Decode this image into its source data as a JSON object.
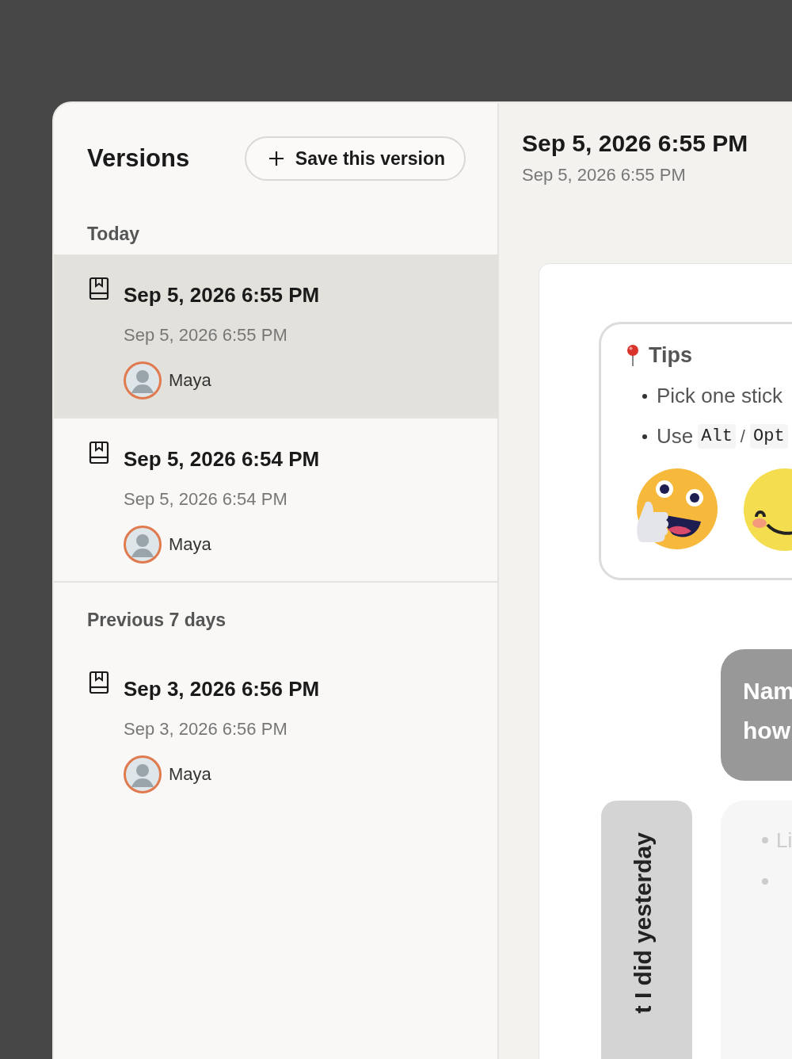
{
  "sidebar": {
    "title": "Versions",
    "save_button": {
      "label": "Save this version"
    },
    "groups": [
      {
        "label": "Today",
        "versions": [
          {
            "title": "Sep 5, 2026 6:55 PM",
            "subtitle": "Sep 5, 2026 6:55 PM",
            "author": "Maya",
            "selected": true
          },
          {
            "title": "Sep 5, 2026 6:54 PM",
            "subtitle": "Sep 5, 2026 6:54 PM",
            "author": "Maya",
            "selected": false
          }
        ]
      },
      {
        "label": "Previous 7 days",
        "versions": [
          {
            "title": "Sep 3, 2026 6:56 PM",
            "subtitle": "Sep 3, 2026 6:56 PM",
            "author": "Maya",
            "selected": false
          }
        ]
      }
    ]
  },
  "detail": {
    "title": "Sep 5, 2026 6:55 PM",
    "subtitle": "Sep 5, 2026 6:55 PM"
  },
  "canvas": {
    "tips": {
      "title": "Tips",
      "bullets": [
        {
          "kind": "text",
          "text": "Pick one stick"
        },
        {
          "kind": "keys",
          "text": "Use",
          "keys": [
            "Alt",
            "Opt"
          ],
          "separator": "/"
        }
      ]
    },
    "stickies": [
      {
        "kind": "dark",
        "lines": [
          "Nam",
          "how"
        ]
      },
      {
        "kind": "vertical",
        "text": "t I did yesterday"
      },
      {
        "kind": "faint",
        "bullets": [
          "Li"
        ]
      }
    ]
  }
}
